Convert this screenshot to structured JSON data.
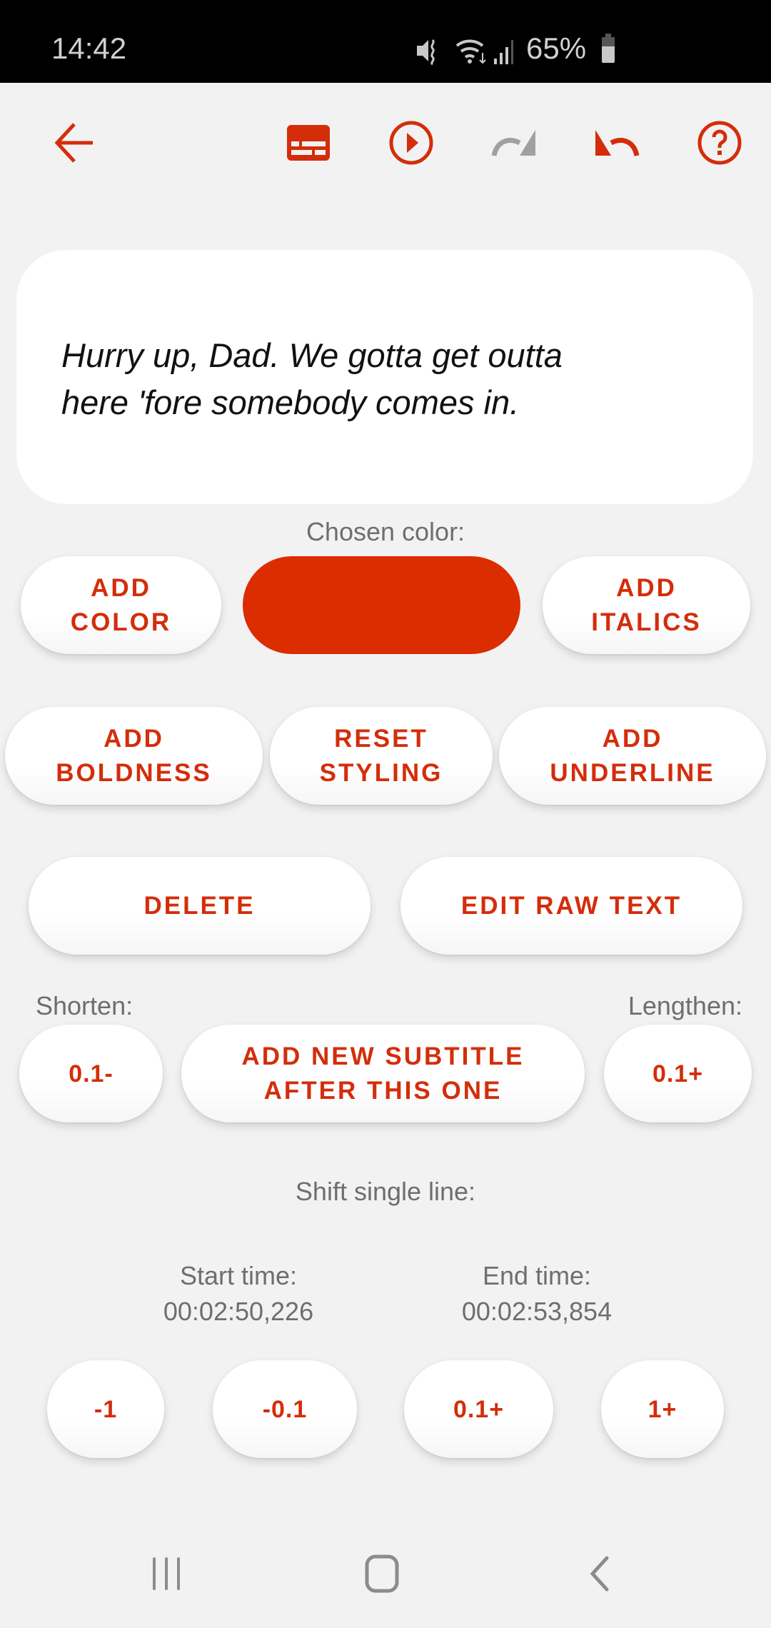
{
  "status_bar": {
    "time": "14:42",
    "battery_percent": "65%",
    "icons": [
      "vibrate-mute-icon",
      "wifi-icon",
      "cellular-signal-icon",
      "battery-icon"
    ]
  },
  "toolbar": {
    "icons": [
      "back-arrow-icon",
      "subtitles-icon",
      "play-circle-icon",
      "redo-icon",
      "undo-icon",
      "help-icon"
    ],
    "redo_enabled": false
  },
  "subtitle": {
    "text_line1": "Hurry up, Dad. We gotta get outta",
    "text_line2": "here 'fore somebody comes in."
  },
  "colors": {
    "accent": "#d42d0a",
    "chosen": "#dc2d00",
    "disabled": "#a0a0a0",
    "background": "#f2f2f2"
  },
  "styling": {
    "chosen_color_label": "Chosen color:",
    "add_color": "ADD\nCOLOR",
    "add_italics": "ADD\nITALICS",
    "add_boldness": "ADD\nBOLDNESS",
    "reset_styling": "RESET\nSTYLING",
    "add_underline": "ADD\nUNDERLINE"
  },
  "actions": {
    "delete": "DELETE",
    "edit_raw_text": "EDIT RAW TEXT"
  },
  "duration": {
    "shorten_label": "Shorten:",
    "lengthen_label": "Lengthen:",
    "shorten_button": "0.1-",
    "lengthen_button": "0.1+",
    "add_new_subtitle": "ADD NEW SUBTITLE\nAFTER THIS ONE"
  },
  "shift": {
    "label": "Shift single line:",
    "start_label": "Start time:",
    "start_value": "00:02:50,226",
    "end_label": "End time:",
    "end_value": "00:02:53,854",
    "buttons": [
      "-1",
      "-0.1",
      "0.1+",
      "1+"
    ]
  },
  "nav_bar": {
    "icons": [
      "recent-apps-icon",
      "home-icon",
      "back-icon"
    ]
  }
}
